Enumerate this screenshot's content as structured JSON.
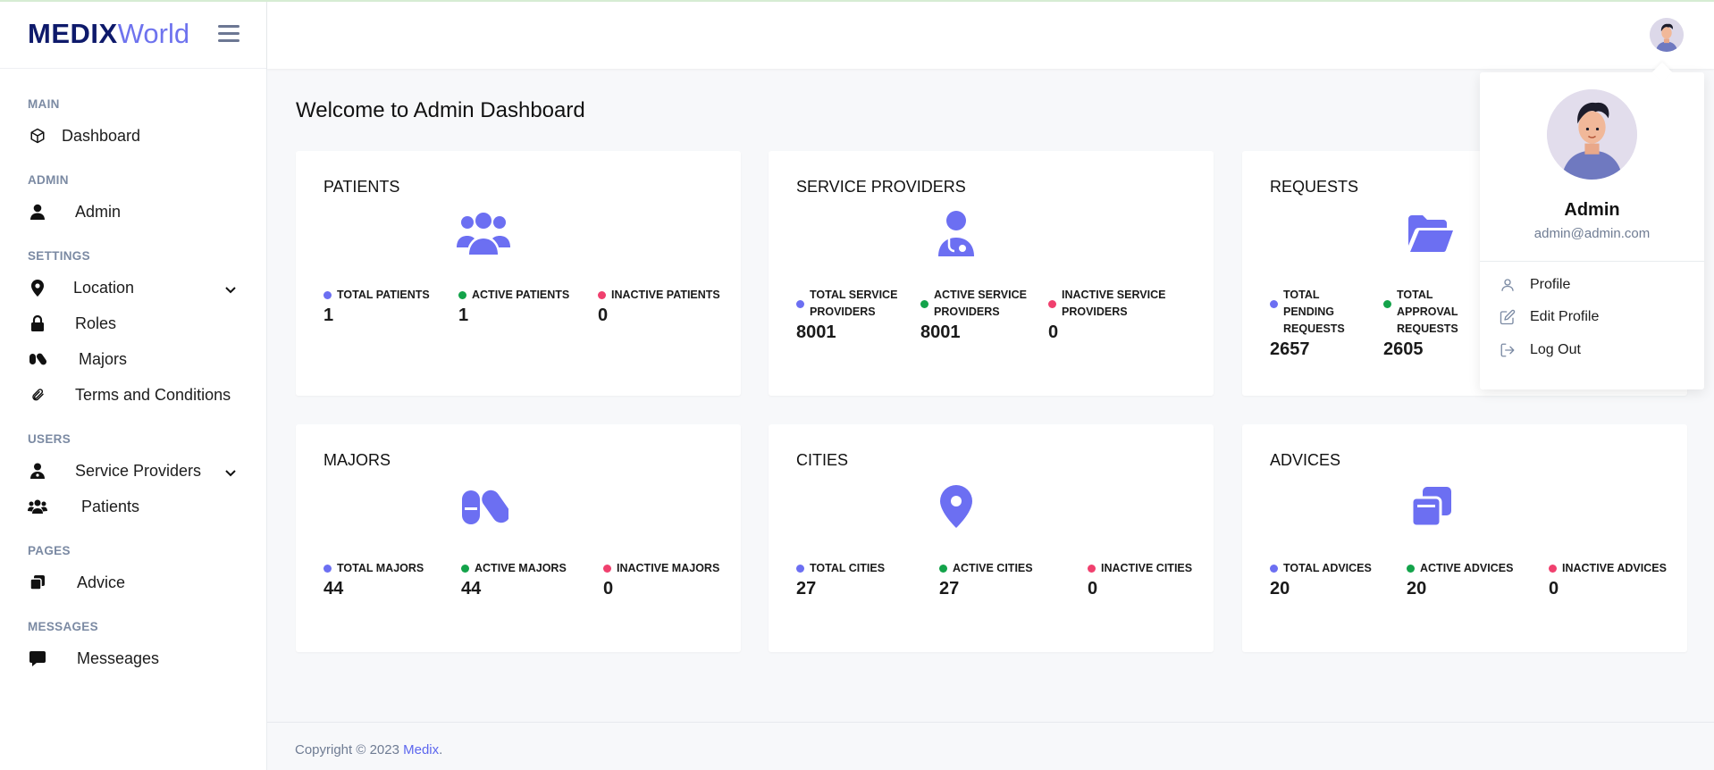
{
  "brand": {
    "bold": "MEDIX",
    "light": "World"
  },
  "sidebar": {
    "sections": {
      "main": "MAIN",
      "admin": "ADMIN",
      "settings": "SETTINGS",
      "users": "USERS",
      "pages": "PAGES",
      "messages": "MESSAGES"
    },
    "items": {
      "dashboard": "Dashboard",
      "admin": "Admin",
      "location": "Location",
      "roles": "Roles",
      "majors": "Majors",
      "terms": "Terms and Conditions",
      "service_providers": "Service Providers",
      "patients": "Patients",
      "advice": "Advice",
      "messages": "Messeages"
    }
  },
  "main": {
    "title": "Welcome to Admin Dashboard",
    "cards": {
      "patients": {
        "title": "PATIENTS",
        "stats": [
          {
            "label": "TOTAL PATIENTS",
            "value": "1"
          },
          {
            "label": "ACTIVE PATIENTS",
            "value": "1"
          },
          {
            "label": "INACTIVE PATIENTS",
            "value": "0"
          }
        ]
      },
      "service_providers": {
        "title": "SERVICE PROVIDERS",
        "stats": [
          {
            "label": "TOTAL SERVICE PROVIDERS",
            "value": "8001"
          },
          {
            "label": "ACTIVE SERVICE PROVIDERS",
            "value": "8001"
          },
          {
            "label": "INACTIVE SERVICE PROVIDERS",
            "value": "0"
          }
        ]
      },
      "requests": {
        "title": "REQUESTS",
        "stats": [
          {
            "label": "TOTAL PENDING REQUESTS",
            "value": "2657"
          },
          {
            "label": "TOTAL APPROVAL REQUESTS",
            "value": "2605"
          }
        ]
      },
      "majors": {
        "title": "MAJORS",
        "stats": [
          {
            "label": "TOTAL MAJORS",
            "value": "44"
          },
          {
            "label": "ACTIVE MAJORS",
            "value": "44"
          },
          {
            "label": "INACTIVE MAJORS",
            "value": "0"
          }
        ]
      },
      "cities": {
        "title": "CITIES",
        "stats": [
          {
            "label": "TOTAL CITIES",
            "value": "27"
          },
          {
            "label": "ACTIVE CITIES",
            "value": "27"
          },
          {
            "label": "INACTIVE CITIES",
            "value": "0"
          }
        ]
      },
      "advices": {
        "title": "ADVICES",
        "stats": [
          {
            "label": "TOTAL ADVICES",
            "value": "20"
          },
          {
            "label": "ACTIVE ADVICES",
            "value": "20"
          },
          {
            "label": "INACTIVE ADVICES",
            "value": "0"
          }
        ]
      }
    }
  },
  "colors": {
    "accent": "#6c6ff2",
    "total_dot": "#6c6ff2",
    "active_dot": "#13a34a",
    "inactive_dot": "#f0406e"
  },
  "footer": {
    "text": "Copyright © 2023",
    "link": "Medix",
    "period": "."
  },
  "dropdown": {
    "name": "Admin",
    "email": "admin@admin.com",
    "items": {
      "profile": "Profile",
      "edit_profile": "Edit Profile",
      "logout": "Log Out"
    }
  }
}
